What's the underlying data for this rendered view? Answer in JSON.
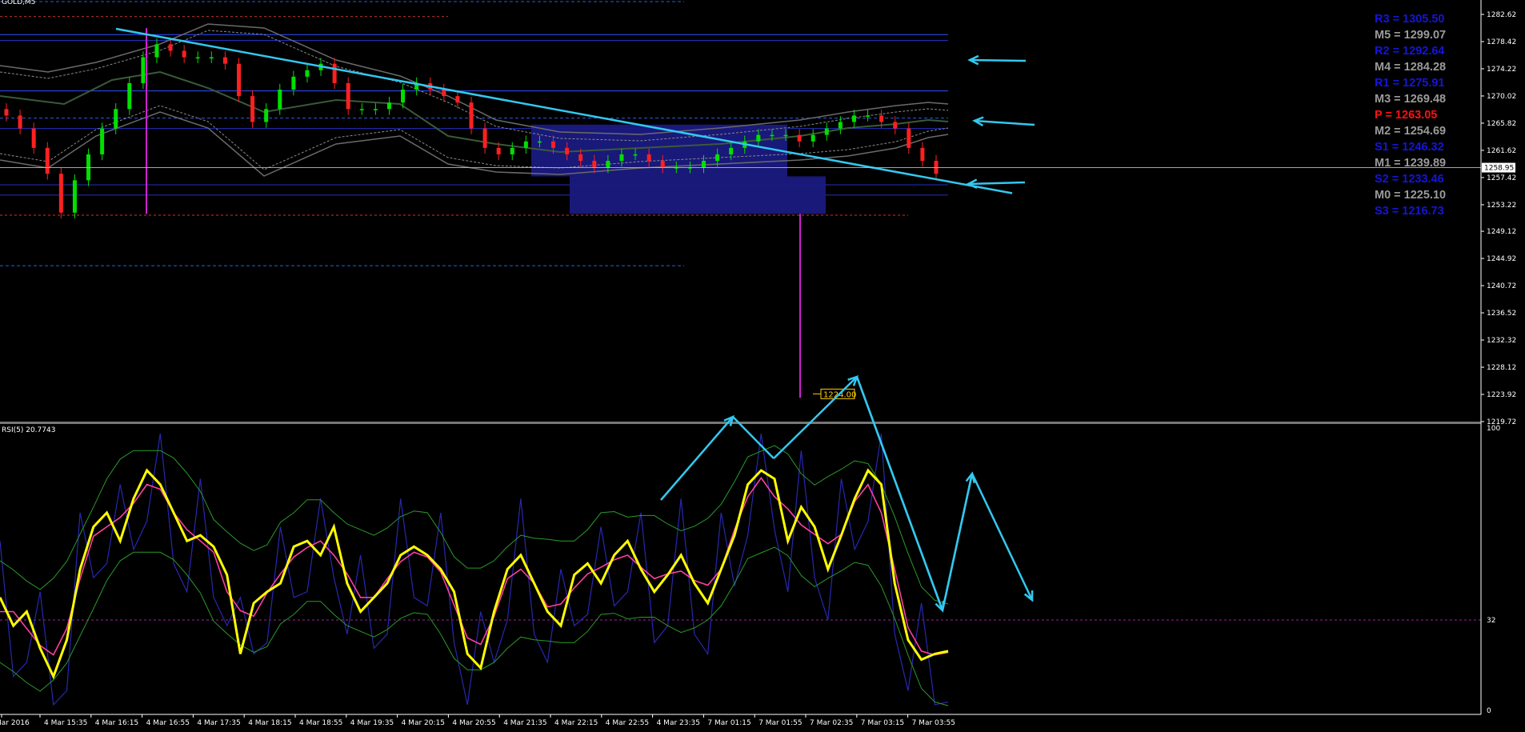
{
  "window": {
    "symbol": "GOLD,M5"
  },
  "rsi": {
    "label": "RSI(5) 20.7743"
  },
  "colors": {
    "bg": "#000000",
    "price_axis": "#ffffff",
    "bull": "#00e000",
    "bear": "#ff2020",
    "trend": "#33c8f0",
    "pivot_blue": "#1515d8",
    "pivot_gray": "#9a9a9a",
    "pivot_red": "#ff1010",
    "rsi_main": "#ffff00",
    "rsi_signal": "#ff3fa0"
  },
  "pivots": [
    {
      "label": "R3 = 1305.50",
      "color": "blue"
    },
    {
      "label": "M5 = 1299.07",
      "color": "gray"
    },
    {
      "label": "R2 = 1292.64",
      "color": "blue"
    },
    {
      "label": "M4 = 1284.28",
      "color": "gray"
    },
    {
      "label": "R1 = 1275.91",
      "color": "blue"
    },
    {
      "label": "M3 = 1269.48",
      "color": "gray"
    },
    {
      "label": "P   = 1263.05",
      "color": "red"
    },
    {
      "label": "M2 = 1254.69",
      "color": "gray"
    },
    {
      "label": "S1 = 1246.32",
      "color": "blue"
    },
    {
      "label": "M1 = 1239.89",
      "color": "gray"
    },
    {
      "label": "S2 = 1233.46",
      "color": "blue"
    },
    {
      "label": "M0 = 1225.10",
      "color": "gray"
    },
    {
      "label": "S3 = 1216.73",
      "color": "blue"
    }
  ],
  "chart_data": [
    {
      "type": "candlestick",
      "price_ticks": [
        "1282.62",
        "1278.42",
        "1274.22",
        "1270.02",
        "1265.82",
        "1261.62",
        "1257.42",
        "1253.22",
        "1249.12",
        "1244.92",
        "1240.72",
        "1236.52",
        "1232.32",
        "1228.12",
        "1223.92",
        "1219.72"
      ],
      "current_price": "1258.95",
      "target_label": "1224.00",
      "time_ticks": [
        "Mar 2016",
        "4 Mar 15:35",
        "4 Mar 16:15",
        "4 Mar 16:55",
        "4 Mar 17:35",
        "4 Mar 18:15",
        "4 Mar 18:55",
        "4 Mar 19:35",
        "4 Mar 20:15",
        "4 Mar 20:55",
        "4 Mar 21:35",
        "4 Mar 22:15",
        "4 Mar 22:55",
        "4 Mar 23:35",
        "7 Mar 01:15",
        "7 Mar 01:55",
        "7 Mar 02:35",
        "7 Mar 03:15",
        "7 Mar 03:55"
      ],
      "ylim": [
        1219.72,
        1282.62
      ],
      "series_close_approx": [
        1267,
        1265,
        1262,
        1258,
        1252,
        1257,
        1261,
        1265,
        1268,
        1272,
        1276,
        1278,
        1277,
        1276,
        1276,
        1276,
        1275,
        1270,
        1266,
        1268,
        1271,
        1273,
        1274,
        1275,
        1272,
        1268,
        1268,
        1268,
        1269,
        1271,
        1272,
        1271,
        1270,
        1269,
        1265,
        1262,
        1261,
        1262,
        1263,
        1263,
        1262,
        1261,
        1260,
        1259,
        1260,
        1261,
        1261,
        1260,
        1259,
        1259,
        1259,
        1260,
        1261,
        1262,
        1263,
        1264,
        1264,
        1264,
        1263,
        1264,
        1265,
        1266,
        1267,
        1267,
        1266,
        1265,
        1262,
        1260,
        1258
      ]
    },
    {
      "type": "line",
      "title": "RSI(5) 20.7743",
      "ylim": [
        0,
        100
      ],
      "levels": [
        "100",
        "32",
        "0"
      ],
      "series": [
        {
          "values": [
            40,
            30,
            35,
            22,
            12,
            25,
            50,
            65,
            70,
            60,
            75,
            85,
            80,
            70,
            60,
            62,
            58,
            48,
            20,
            38,
            42,
            45,
            58,
            60,
            55,
            65,
            45,
            35,
            40,
            45,
            55,
            58,
            55,
            50,
            42,
            20,
            15,
            35,
            50,
            55,
            45,
            35,
            30,
            48,
            52,
            45,
            55,
            60,
            50,
            42,
            48,
            55,
            45,
            38,
            50,
            62,
            80,
            85,
            82,
            60,
            72,
            65,
            50,
            62,
            75,
            85,
            80,
            45,
            25,
            18,
            20,
            21
          ]
        }
      ]
    }
  ]
}
